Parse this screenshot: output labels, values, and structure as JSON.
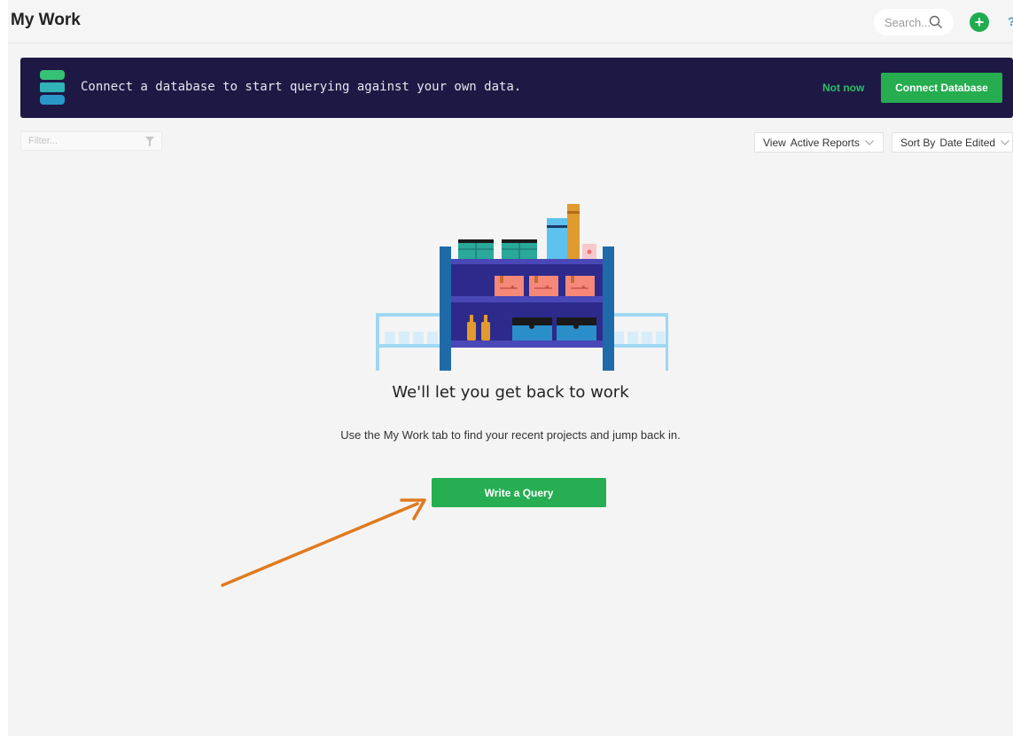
{
  "header": {
    "title": "My Work",
    "search_placeholder": "Search...",
    "add_label": "+",
    "help_label": "?"
  },
  "banner": {
    "message": "Connect a database to start querying against your own data.",
    "not_now_label": "Not now",
    "connect_label": "Connect Database"
  },
  "toolbar": {
    "filter_placeholder": "Filter...",
    "view": {
      "label": "View",
      "value": "Active Reports"
    },
    "sort": {
      "label": "Sort By",
      "value": "Date Edited"
    }
  },
  "empty_state": {
    "title": "We'll let you get back to work",
    "subtitle": "Use the My Work tab to find your recent projects and jump back in.",
    "button_label": "Write a Query"
  },
  "colors": {
    "banner_bg": "#1e1844",
    "accent_green": "#27ad52",
    "annotation_arrow": "#e07a1e",
    "shelf_blue": "#2d2a8c"
  },
  "icons": [
    "search-icon",
    "plus-icon",
    "help-icon",
    "database-icon",
    "filter-icon",
    "chevron-down-icon"
  ]
}
